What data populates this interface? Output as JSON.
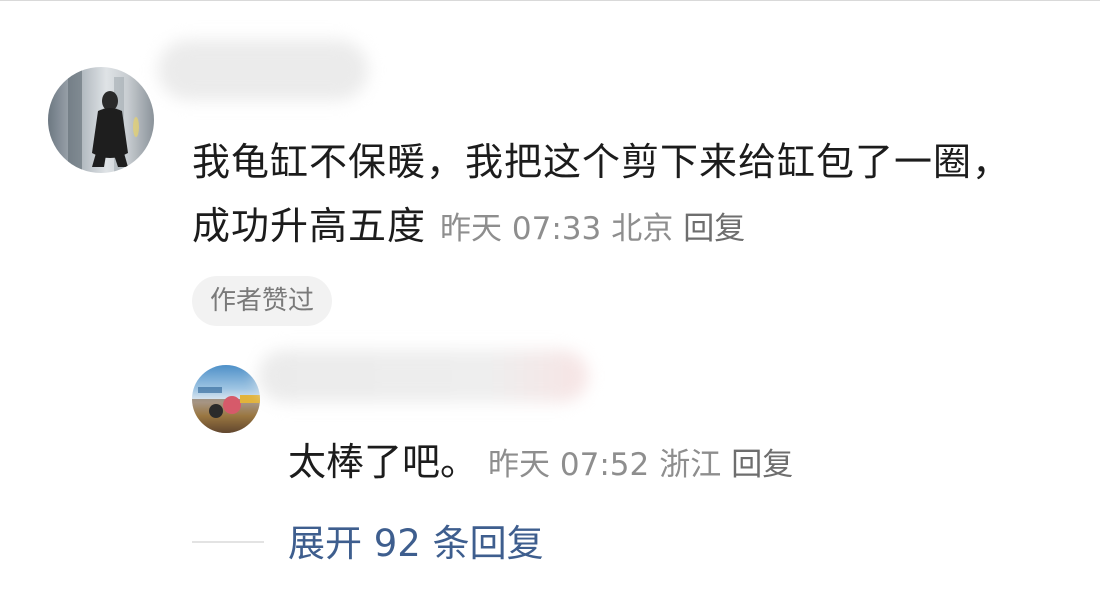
{
  "comment": {
    "text_line1": "我龟缸不保暖，我把这个剪下来给缸包了一圈，",
    "text_line2": "成功升高五度",
    "time": "昨天 07:33",
    "location": "北京",
    "reply_label": "回复",
    "badge": "作者赞过"
  },
  "reply": {
    "text": "太棒了吧。",
    "time": "昨天 07:52",
    "location": "浙江",
    "reply_label": "回复"
  },
  "expand": {
    "label": "展开 92 条回复"
  },
  "colors": {
    "link": "#3e5e8e",
    "meta": "#8e8e8e",
    "badge_bg": "#f2f2f2"
  }
}
